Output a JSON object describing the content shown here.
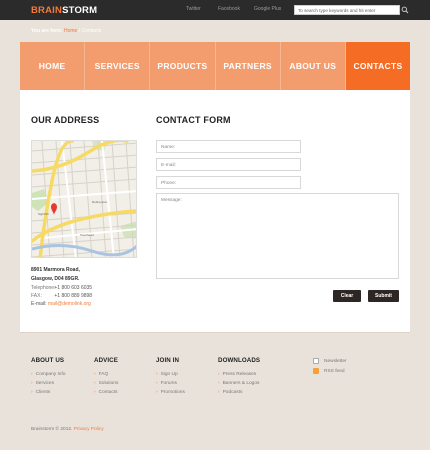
{
  "logo": {
    "part1": "BRAIN",
    "part2": "STORM"
  },
  "top_links": [
    "Twitter",
    "Facebook",
    "Google Plus"
  ],
  "search": {
    "placeholder": "To search type keywords and hit enter"
  },
  "breadcrumb": {
    "label": "You are here:",
    "home": "Home",
    "separator": "/",
    "current": "Contacts"
  },
  "nav": [
    {
      "label": "HOME",
      "active": false
    },
    {
      "label": "SERVICES",
      "active": false
    },
    {
      "label": "PRODUCTS",
      "active": false
    },
    {
      "label": "PARTNERS",
      "active": false
    },
    {
      "label": "ABOUT US",
      "active": false
    },
    {
      "label": "CONTACTS",
      "active": true
    }
  ],
  "address": {
    "title": "OUR ADDRESS",
    "line1": "8901 Marmora Road,",
    "line2": "Glasgow, D04 89GR.",
    "telephone_label": "Telephone:",
    "telephone": "+1 800 603 6035",
    "fax_label": "FAX:",
    "fax": "+1 800 889 9898",
    "email_label": "E-mail:",
    "email": "mail@demolink.org"
  },
  "contact_form": {
    "title": "CONTACT FORM",
    "name_placeholder": "Name:",
    "email_placeholder": "E-mail:",
    "phone_placeholder": "Phone:",
    "message_placeholder": "Message:",
    "clear_label": "Clear",
    "submit_label": "Submit"
  },
  "footer": {
    "columns": [
      {
        "title": "ABOUT US",
        "links": [
          "Company Info",
          "Services",
          "Clients"
        ]
      },
      {
        "title": "ADVICE",
        "links": [
          "FAQ",
          "Solutions",
          "Contacts"
        ]
      },
      {
        "title": "JOIN IN",
        "links": [
          "Sign Up",
          "Forums",
          "Promotions"
        ]
      },
      {
        "title": "DOWNLOADS",
        "links": [
          "Press Releases",
          "Banners & Logos",
          "Podcasts"
        ]
      }
    ],
    "social": [
      "Newsletter",
      "RSS feed"
    ],
    "copyright": "Brainstorm © 2012.",
    "privacy": "Privacy Policy"
  },
  "colors": {
    "accent": "#f07a3a",
    "nav_bg": "#f39d6f",
    "nav_active": "#f56d24",
    "topbar": "#2b2b2b",
    "page_bg": "#e9e2da"
  }
}
